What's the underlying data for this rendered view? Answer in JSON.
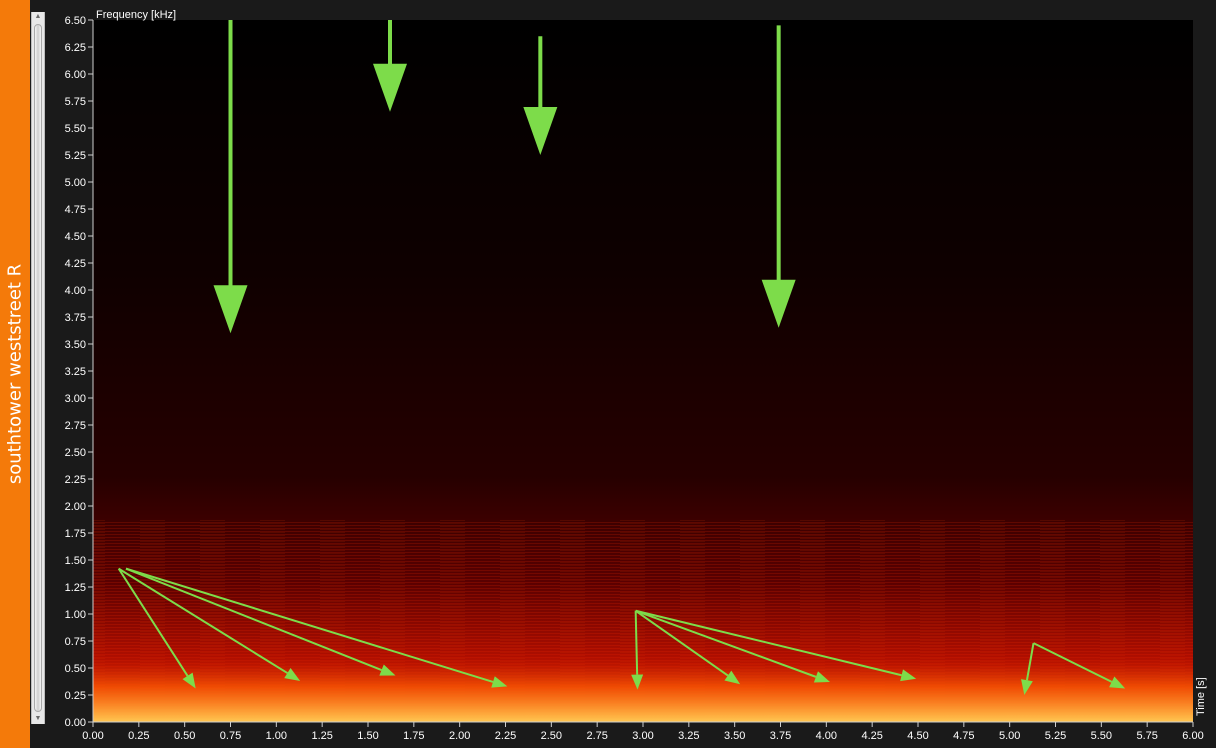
{
  "track": {
    "label": "southtower weststreet R"
  },
  "chart_data": {
    "type": "heatmap",
    "ylabel": "Frequency [kHz]",
    "xlabel": "Time [s]",
    "xlim": [
      0,
      6
    ],
    "ylim": [
      0,
      6.5
    ],
    "x_ticks": [
      "0.00",
      "0.25",
      "0.50",
      "0.75",
      "1.00",
      "1.25",
      "1.50",
      "1.75",
      "2.00",
      "2.25",
      "2.50",
      "2.75",
      "3.00",
      "3.25",
      "3.50",
      "3.75",
      "4.00",
      "4.25",
      "4.50",
      "4.75",
      "5.00",
      "5.25",
      "5.50",
      "5.75",
      "6.00"
    ],
    "y_ticks": [
      "0.00",
      "0.25",
      "0.50",
      "0.75",
      "1.00",
      "1.25",
      "1.50",
      "1.75",
      "2.00",
      "2.25",
      "2.50",
      "2.75",
      "3.00",
      "3.25",
      "3.50",
      "3.75",
      "4.00",
      "4.25",
      "4.50",
      "4.75",
      "5.00",
      "5.25",
      "5.50",
      "5.75",
      "6.00",
      "6.25",
      "6.50"
    ],
    "colors": {
      "background": "#000000",
      "low": "#3a0000",
      "mid": "#c81400",
      "high": "#ffe680",
      "annotation": "#7ddc4a"
    },
    "annotations": {
      "down_arrows": [
        {
          "x": 0.75,
          "y_from": 6.5,
          "y_to": 3.6
        },
        {
          "x": 1.62,
          "y_from": 6.55,
          "y_to": 5.65
        },
        {
          "x": 2.44,
          "y_from": 6.35,
          "y_to": 5.25
        },
        {
          "x": 3.74,
          "y_from": 6.45,
          "y_to": 3.65
        }
      ],
      "fan_arrows": [
        {
          "from": [
            0.14,
            1.42
          ],
          "to": [
            0.56,
            0.31
          ]
        },
        {
          "from": [
            0.14,
            1.42
          ],
          "to": [
            1.13,
            0.38
          ]
        },
        {
          "from": [
            0.18,
            1.42
          ],
          "to": [
            1.65,
            0.43
          ]
        },
        {
          "from": [
            0.18,
            1.42
          ],
          "to": [
            2.26,
            0.33
          ]
        },
        {
          "from": [
            2.96,
            1.03
          ],
          "to": [
            2.97,
            0.3
          ]
        },
        {
          "from": [
            2.96,
            1.03
          ],
          "to": [
            3.53,
            0.35
          ]
        },
        {
          "from": [
            2.96,
            1.03
          ],
          "to": [
            4.02,
            0.37
          ]
        },
        {
          "from": [
            2.96,
            1.03
          ],
          "to": [
            4.49,
            0.4
          ]
        },
        {
          "from": [
            5.13,
            0.73
          ],
          "to": [
            5.08,
            0.25
          ]
        },
        {
          "from": [
            5.13,
            0.73
          ],
          "to": [
            5.63,
            0.31
          ]
        }
      ]
    }
  }
}
